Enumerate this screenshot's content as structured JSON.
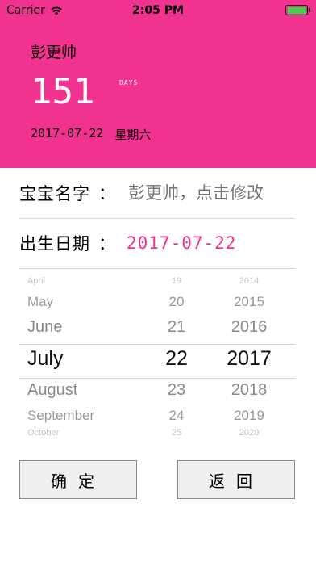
{
  "status_bar": {
    "carrier": "Carrier",
    "time": "2:05 PM",
    "battery_color": "#3dd14a"
  },
  "header": {
    "name": "彭更帅",
    "days_count": "151",
    "days_unit": "DAYS",
    "date": "2017-07-22",
    "weekday": "星期六",
    "bg_color": "#f1338f"
  },
  "form": {
    "name_label": "宝宝名字",
    "name_colon": "：",
    "name_placeholder": "彭更帅，点击修改",
    "birth_label": "出生日期",
    "birth_colon": "：",
    "birth_value": "2017-07-22"
  },
  "picker": {
    "months": [
      "April",
      "May",
      "June",
      "July",
      "August",
      "September",
      "October"
    ],
    "days": [
      "19",
      "20",
      "21",
      "22",
      "23",
      "24",
      "25"
    ],
    "years": [
      "2014",
      "2015",
      "2016",
      "2017",
      "2018",
      "2019",
      "2020"
    ],
    "selected": {
      "month": "July",
      "day": "22",
      "year": "2017"
    }
  },
  "buttons": {
    "confirm": "确定",
    "back": "返回"
  }
}
